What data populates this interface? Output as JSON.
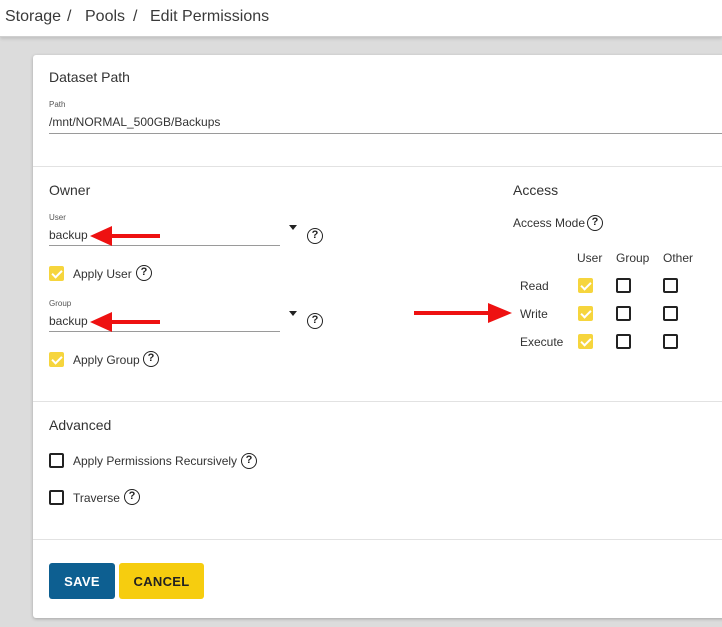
{
  "breadcrumb": {
    "items": [
      "Storage",
      "Pools",
      "Edit Permissions"
    ],
    "separator": "/"
  },
  "dataset_path": {
    "title": "Dataset Path",
    "path_label": "Path",
    "path_value": "/mnt/NORMAL_500GB/Backups"
  },
  "owner": {
    "title": "Owner",
    "user_label": "User",
    "user_value": "backup",
    "apply_user_label": "Apply User",
    "apply_user_checked": true,
    "group_label": "Group",
    "group_value": "backup",
    "apply_group_label": "Apply Group",
    "apply_group_checked": true
  },
  "access": {
    "title": "Access",
    "mode_label": "Access Mode",
    "columns": [
      "User",
      "Group",
      "Other"
    ],
    "rows": [
      {
        "label": "Read",
        "user": true,
        "group": false,
        "other": false
      },
      {
        "label": "Write",
        "user": true,
        "group": false,
        "other": false
      },
      {
        "label": "Execute",
        "user": true,
        "group": false,
        "other": false
      }
    ]
  },
  "advanced": {
    "title": "Advanced",
    "recursive_label": "Apply Permissions Recursively",
    "recursive_checked": false,
    "traverse_label": "Traverse",
    "traverse_checked": false
  },
  "actions": {
    "save_label": "SAVE",
    "cancel_label": "CANCEL"
  },
  "colors": {
    "accent_checkbox": "#f6d53d",
    "save_button": "#0d5f91",
    "cancel_button": "#f6cd0f",
    "annotation_arrow": "#ee1111"
  },
  "icons": {
    "help": "help-circle-icon",
    "dropdown": "caret-down-icon",
    "annotation": "red-arrow-icon"
  }
}
